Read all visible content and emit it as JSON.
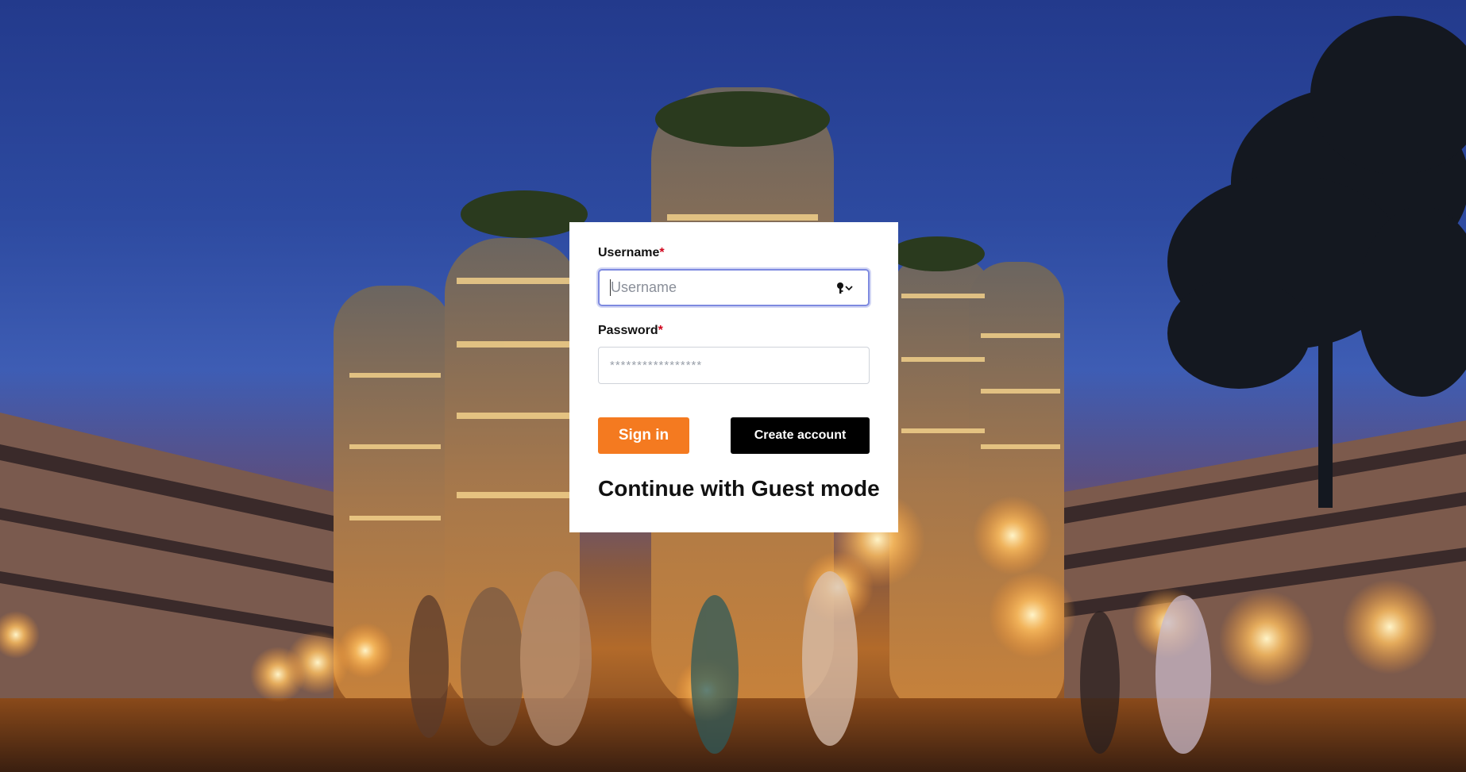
{
  "login": {
    "username_label": "Username",
    "username_required_mark": "*",
    "username_placeholder": "Username",
    "username_value": "",
    "password_label": "Password",
    "password_required_mark": "*",
    "password_placeholder": "*****************",
    "password_value": "",
    "signin_label": "Sign in",
    "create_label": "Create account",
    "guest_label": "Continue with Guest mode"
  },
  "icons": {
    "password_manager": "key-icon",
    "dropdown": "chevron-down-icon"
  },
  "colors": {
    "accent": "#f47a20",
    "focus_ring": "#7e8ae0",
    "required": "#d0021b",
    "dark_button": "#000000"
  }
}
